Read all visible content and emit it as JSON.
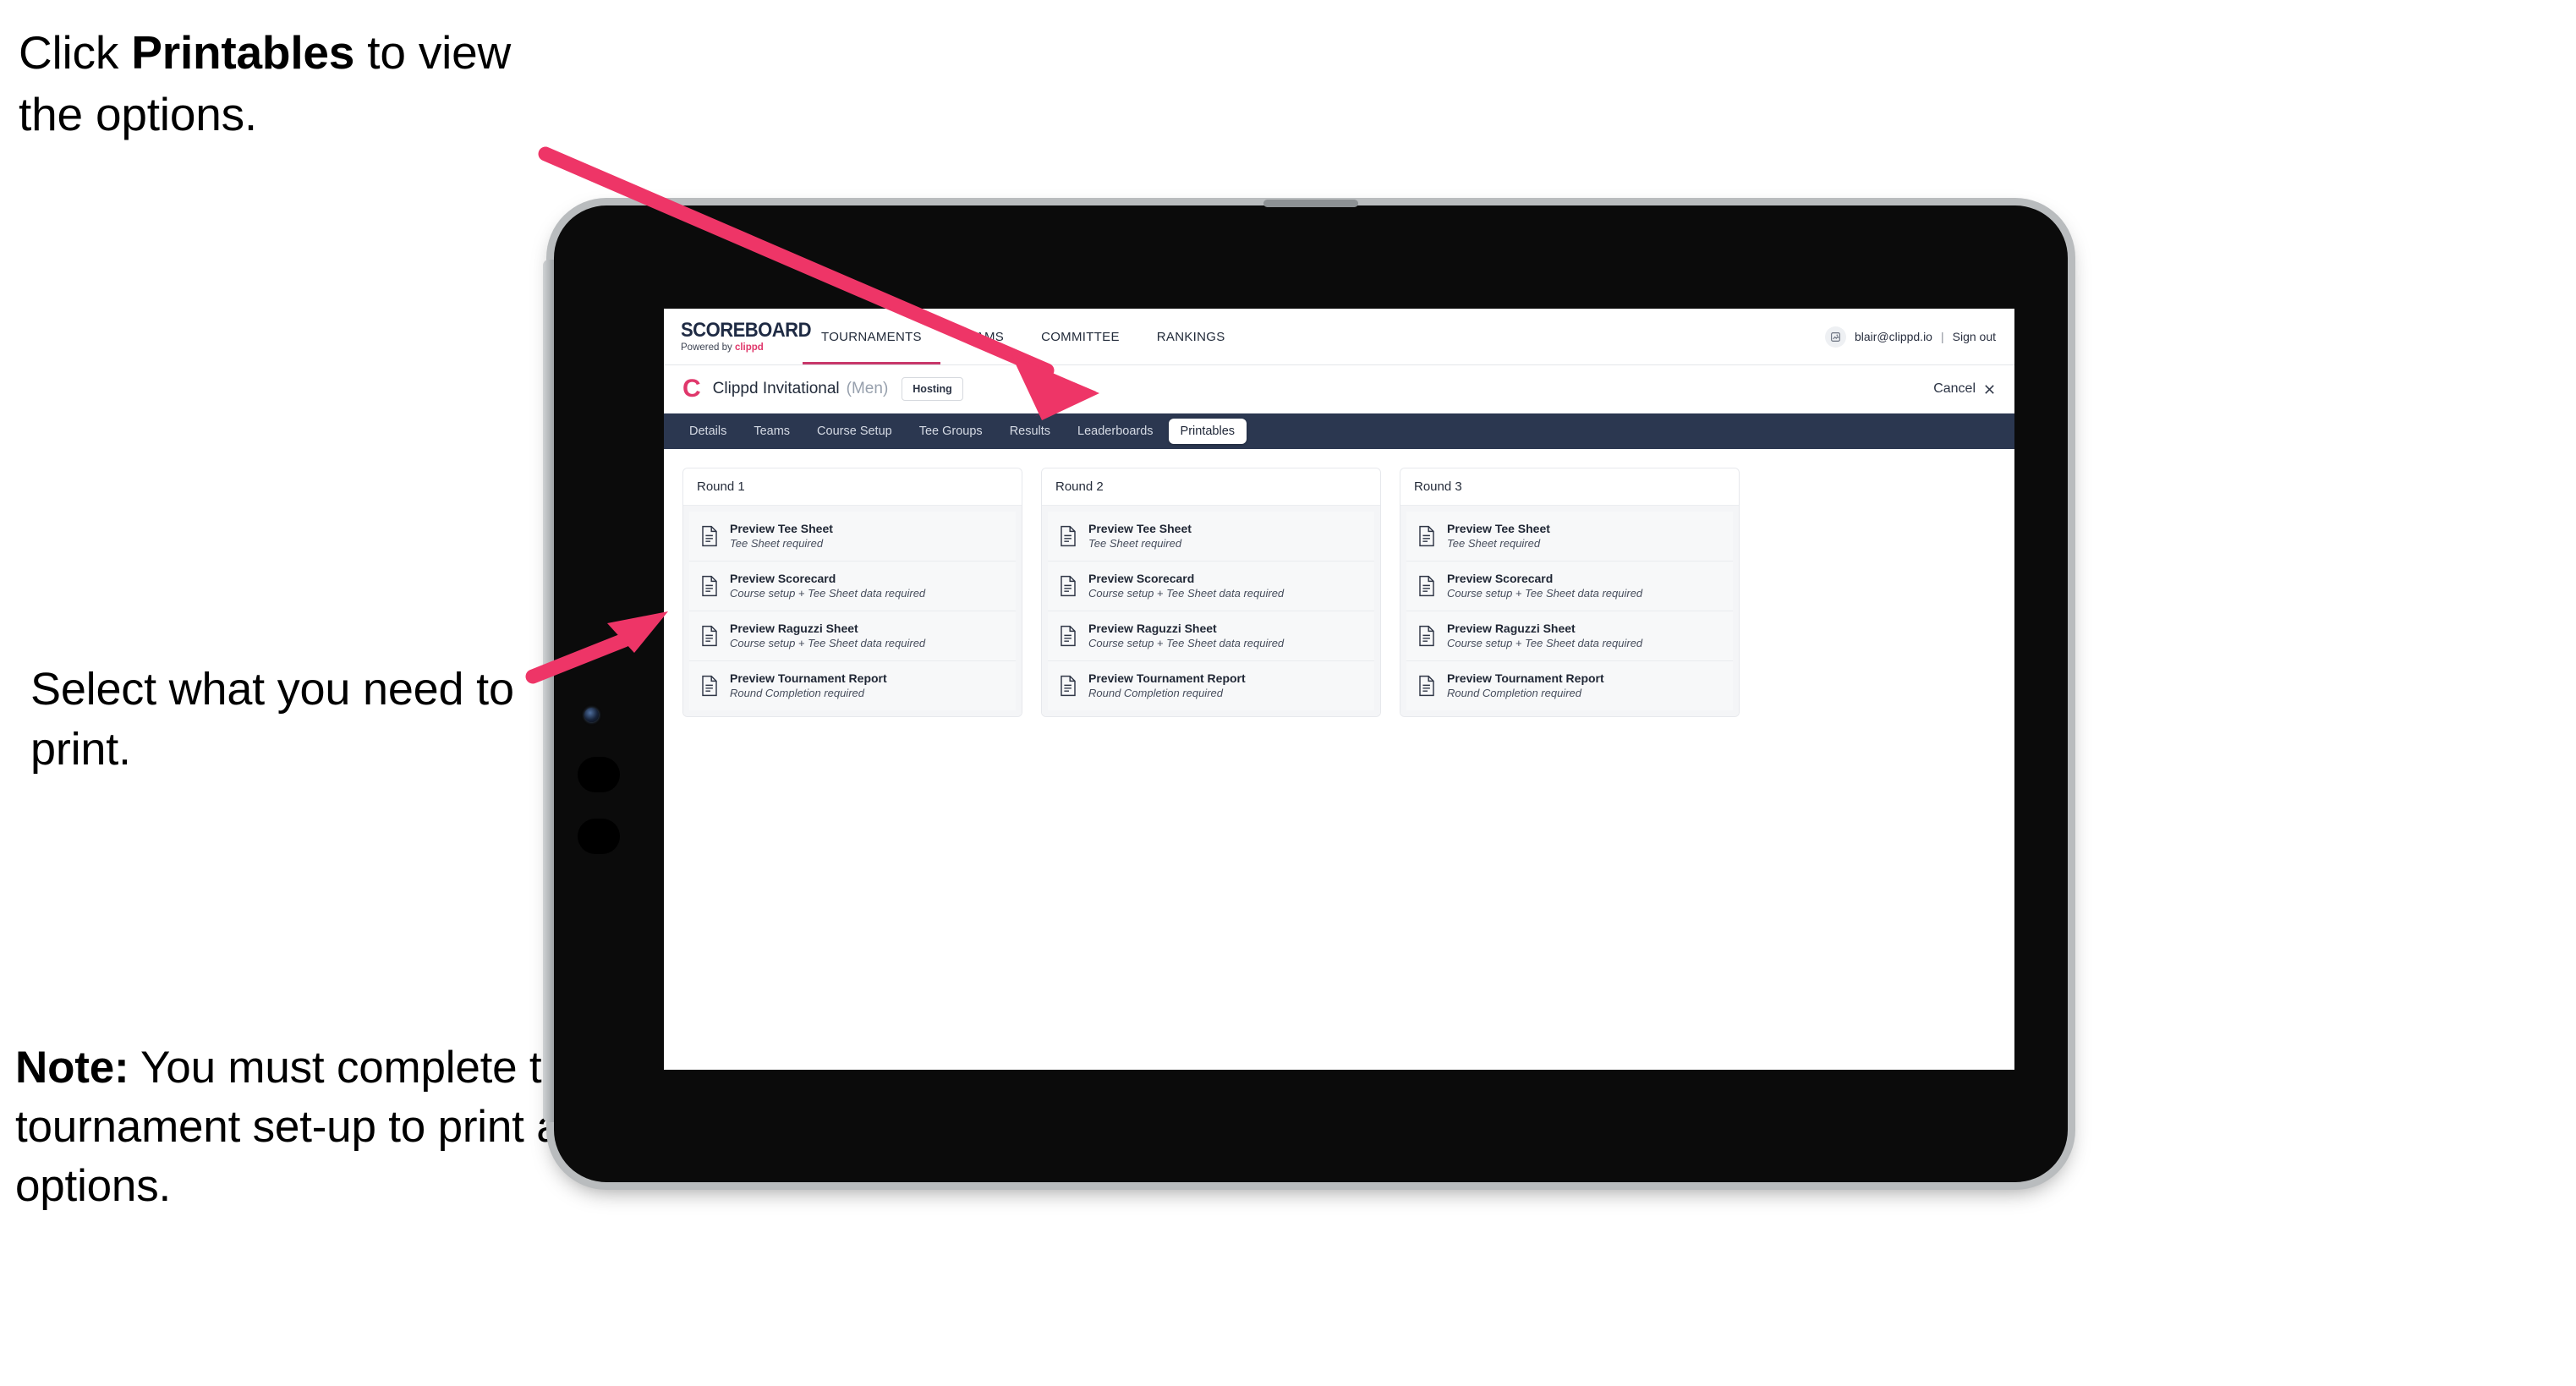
{
  "annotations": {
    "top": {
      "before": "Click ",
      "bold": "Printables",
      "after": " to view the options."
    },
    "middle": {
      "text": "Select what you need to print."
    },
    "note": {
      "bold": "Note:",
      "text": " You must complete the tournament set-up to print all the options."
    }
  },
  "colors": {
    "arrow": "#EE3567",
    "brand_pink": "#E0376B",
    "tabbar_navy": "#2B3750",
    "active_underline": "#C8386A"
  },
  "app": {
    "brand": {
      "title": "SCOREBOARD",
      "powered_prefix": "Powered by ",
      "powered_name": "clippd"
    },
    "top_nav": [
      {
        "label": "TOURNAMENTS",
        "active": true
      },
      {
        "label": "TEAMS",
        "active": false
      },
      {
        "label": "COMMITTEE",
        "active": false
      },
      {
        "label": "RANKINGS",
        "active": false
      }
    ],
    "account": {
      "avatar_icon": "user-avatar-icon",
      "email": "blair@clippd.io",
      "separator": "|",
      "sign_out": "Sign out"
    },
    "event": {
      "logo_letter": "C",
      "name": "Clippd Invitational",
      "gender": "(Men)",
      "status_badge": "Hosting",
      "cancel_label": "Cancel",
      "cancel_icon": "close-icon"
    },
    "tabs": [
      {
        "label": "Details",
        "active": false
      },
      {
        "label": "Teams",
        "active": false
      },
      {
        "label": "Course Setup",
        "active": false
      },
      {
        "label": "Tee Groups",
        "active": false
      },
      {
        "label": "Results",
        "active": false
      },
      {
        "label": "Leaderboards",
        "active": false
      },
      {
        "label": "Printables",
        "active": true
      }
    ],
    "rounds": [
      {
        "title": "Round 1",
        "items": [
          {
            "title": "Preview Tee Sheet",
            "subtitle": "Tee Sheet required",
            "icon": "document-icon"
          },
          {
            "title": "Preview Scorecard",
            "subtitle": "Course setup + Tee Sheet data required",
            "icon": "document-icon"
          },
          {
            "title": "Preview Raguzzi Sheet",
            "subtitle": "Course setup + Tee Sheet data required",
            "icon": "document-icon"
          },
          {
            "title": "Preview Tournament Report",
            "subtitle": "Round Completion required",
            "icon": "document-icon"
          }
        ]
      },
      {
        "title": "Round 2",
        "items": [
          {
            "title": "Preview Tee Sheet",
            "subtitle": "Tee Sheet required",
            "icon": "document-icon"
          },
          {
            "title": "Preview Scorecard",
            "subtitle": "Course setup + Tee Sheet data required",
            "icon": "document-icon"
          },
          {
            "title": "Preview Raguzzi Sheet",
            "subtitle": "Course setup + Tee Sheet data required",
            "icon": "document-icon"
          },
          {
            "title": "Preview Tournament Report",
            "subtitle": "Round Completion required",
            "icon": "document-icon"
          }
        ]
      },
      {
        "title": "Round 3",
        "items": [
          {
            "title": "Preview Tee Sheet",
            "subtitle": "Tee Sheet required",
            "icon": "document-icon"
          },
          {
            "title": "Preview Scorecard",
            "subtitle": "Course setup + Tee Sheet data required",
            "icon": "document-icon"
          },
          {
            "title": "Preview Raguzzi Sheet",
            "subtitle": "Course setup + Tee Sheet data required",
            "icon": "document-icon"
          },
          {
            "title": "Preview Tournament Report",
            "subtitle": "Round Completion required",
            "icon": "document-icon"
          }
        ]
      }
    ]
  }
}
